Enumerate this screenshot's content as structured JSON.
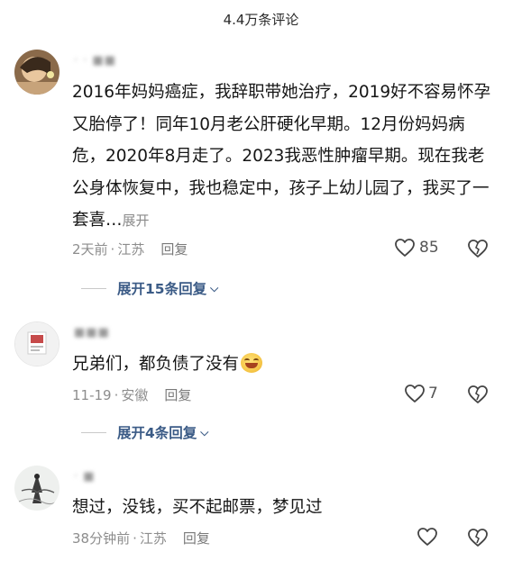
{
  "header": {
    "title": "4.4万条评论"
  },
  "comments": [
    {
      "username": "· · ■■",
      "text": "2016年妈妈癌症，我辞职带她治疗，2019好不容易怀孕又胎停了！同年10月老公肝硬化早期。12月份妈妈病危，2020年8月走了。2023我恶性肿瘤早期。现在我老公身体恢复中，我也稳定中，孩子上幼儿园了，我买了一套喜…",
      "expand_label": "展开",
      "time": "2天前",
      "location": "江苏",
      "reply_label": "回复",
      "likes": "85",
      "replies_label": "展开15条回复",
      "avatar_icon": "photo-avatar"
    },
    {
      "username": "■■■",
      "text": "兄弟们，都负债了没有",
      "time": "11-19",
      "location": "安徽",
      "reply_label": "回复",
      "likes": "7",
      "replies_label": "展开4条回复",
      "avatar_icon": "card-avatar"
    },
    {
      "username": "· ■",
      "text": "想过，没钱，买不起邮票，梦见过",
      "time": "38分钟前",
      "location": "江苏",
      "reply_label": "回复",
      "likes": "",
      "avatar_icon": "ink-painting-avatar"
    }
  ],
  "separator": "·",
  "colors": {
    "link": "#3b5b86",
    "meta": "#8d8d8d"
  }
}
